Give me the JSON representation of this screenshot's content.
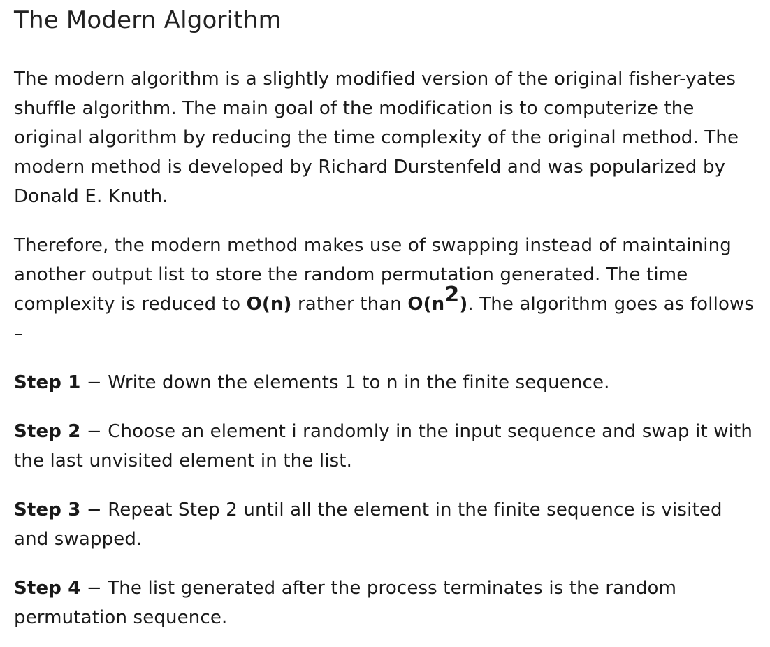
{
  "heading": "The Modern Algorithm",
  "para1": "The modern algorithm is a slightly modified version of the original fisher-yates shuffle algorithm. The main goal of the modification is to computerize the original algorithm by reducing the time complexity of the original method. The modern method is developed by Richard Durstenfeld and was popularized by Donald E. Knuth.",
  "para2": {
    "text_before": "Therefore, the modern method makes use of swapping instead of maintaining another output list to store the random permutation generated. The time complexity is reduced to ",
    "o_n": "O(n)",
    "middle": " rather than ",
    "o_n2_base": "O(n",
    "o_n2_exp": "2",
    "o_n2_close": ")",
    "after": ". The algorithm goes as follows –"
  },
  "steps": [
    {
      "label": "Step 1",
      "sep": " − ",
      "text": "Write down the elements 1 to n in the finite sequence."
    },
    {
      "label": "Step 2",
      "sep": " − ",
      "text": "Choose an element i randomly in the input sequence and swap it with the last unvisited element in the list."
    },
    {
      "label": "Step 3",
      "sep": " − ",
      "text": "Repeat Step 2 until all the element in the finite sequence is visited and swapped."
    },
    {
      "label": "Step 4",
      "sep": " − ",
      "text": "The list generated after the process terminates is the random permutation sequence."
    }
  ]
}
